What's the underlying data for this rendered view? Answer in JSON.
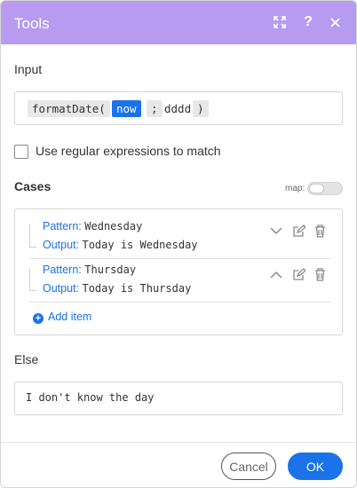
{
  "header": {
    "title": "Tools",
    "bg_color": "#b69bf0",
    "icons": [
      "expand-icon",
      "help-icon",
      "close-icon"
    ],
    "help_label": "?"
  },
  "input": {
    "label": "Input",
    "fn": "formatDate(",
    "arg_now": "now",
    "semicolon": ";",
    "format": "dddd",
    "close_paren": ")"
  },
  "regex": {
    "label": "Use regular expressions to match",
    "checked": false
  },
  "cases": {
    "label": "Cases",
    "map_label": "map:",
    "map_on": false,
    "pattern_key": "Pattern:",
    "output_key": "Output:",
    "items": [
      {
        "pattern": "Wednesday",
        "output": "Today is Wednesday",
        "expanded": false
      },
      {
        "pattern": "Thursday",
        "output": "Today is Thursday",
        "expanded": true
      }
    ],
    "add_label": "Add item"
  },
  "else": {
    "label": "Else",
    "value": "I don't know the day"
  },
  "footer": {
    "cancel_label": "Cancel",
    "ok_label": "OK",
    "accent": "#1a73e8"
  }
}
